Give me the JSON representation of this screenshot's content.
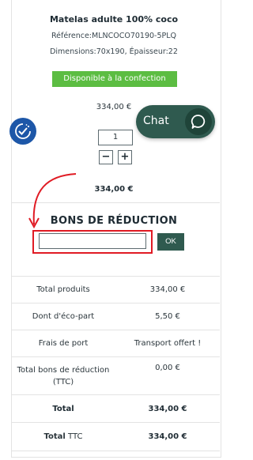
{
  "product": {
    "name": "Matelas adulte 100% coco",
    "reference": "Référence:MLNCOCO70190-5PLQ",
    "dimensions": "Dimensions:70x190, Épaisseur:22",
    "availability": "Disponible à la confection",
    "unit_price": "334,00 €",
    "quantity": "1",
    "line_total": "334,00 €"
  },
  "chat": {
    "label": "Chat"
  },
  "qty_controls": {
    "minus": "−",
    "plus": "+"
  },
  "coupon": {
    "title": "BONS DE RÉDUCTION",
    "value": "",
    "ok_label": "OK"
  },
  "totals": [
    {
      "label": "Total produits",
      "value": "334,00 €"
    },
    {
      "label": "Dont d'éco-part",
      "value": "5,50 €"
    },
    {
      "label": "Frais de port",
      "value": "Transport offert !"
    },
    {
      "label": "Total bons de réduction (TTC)",
      "value": "0,00 €"
    },
    {
      "label": "Total",
      "value": "334,00 €"
    },
    {
      "label_bold": "Total",
      "label_rest": " TTC",
      "value": "334,00 €"
    }
  ],
  "colors": {
    "accent_green": "#5cbd42",
    "dark_green": "#2f5a4f",
    "badge_blue": "#1d57a8",
    "highlight_red": "#e01b24"
  },
  "icons": {
    "badge": "check-badge-icon",
    "chat": "chat-bubble-icon",
    "annotation": "curved-arrow-icon"
  }
}
